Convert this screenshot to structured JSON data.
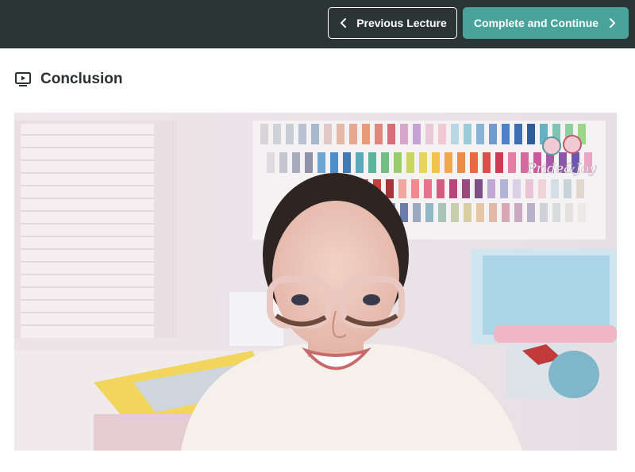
{
  "header": {
    "previous_label": "Previous Lecture",
    "continue_label": "Complete and Continue"
  },
  "lecture": {
    "title": "Conclusion"
  },
  "video": {
    "watermark_text": "Pride&Joy"
  },
  "colors": {
    "topbar": "#2c3535",
    "accent": "#4aa39a",
    "title_text": "#2b2f33"
  },
  "icons": {
    "previous": "chevron-left-icon",
    "continue": "chevron-right-icon",
    "lecture": "video-play-icon"
  }
}
